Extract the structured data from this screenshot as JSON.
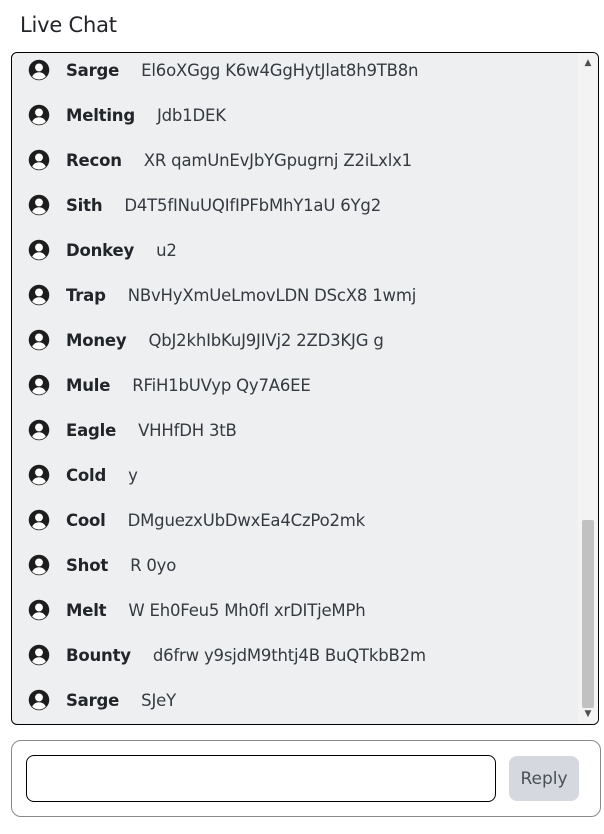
{
  "title": "Live Chat",
  "messages": [
    {
      "user": "Sarge",
      "text": "El6oXGgg K6w4GgHytJlat8h9TB8n"
    },
    {
      "user": "Melting",
      "text": "Jdb1DEK"
    },
    {
      "user": "Recon",
      "text": "XR qamUnEvJbYGpugrnj Z2iLxlx1"
    },
    {
      "user": "Sith",
      "text": "D4T5fINuUQIfIPFbMhY1aU 6Yg2"
    },
    {
      "user": "Donkey",
      "text": "u2"
    },
    {
      "user": "Trap",
      "text": "NBvHyXmUeLmovLDN DScX8 1wmj"
    },
    {
      "user": "Money",
      "text": "QbJ2khIbKuJ9JIVj2 2ZD3KJG g"
    },
    {
      "user": "Mule",
      "text": "RFiH1bUVyp Qy7A6EE"
    },
    {
      "user": "Eagle",
      "text": "VHHfDH 3tB"
    },
    {
      "user": "Cold",
      "text": "y"
    },
    {
      "user": "Cool",
      "text": "DMguezxUbDwxEa4CzPo2mk"
    },
    {
      "user": "Shot",
      "text": "R 0yo"
    },
    {
      "user": "Melt",
      "text": "W Eh0Feu5 Mh0fl xrDITjeMPh"
    },
    {
      "user": "Bounty",
      "text": "d6frw y9sjdM9thtj4B BuQTkbB2m"
    },
    {
      "user": "Sarge",
      "text": "SJeY"
    }
  ],
  "reply": {
    "input_value": "",
    "button_label": "Reply"
  },
  "icons": {
    "avatar": "user-circle-icon",
    "scroll_up": "scroll-up-arrow-icon",
    "scroll_down": "scroll-down-arrow-icon"
  },
  "colors": {
    "chat_background": "#eeeff1",
    "reply_button": "#d5d8de"
  }
}
